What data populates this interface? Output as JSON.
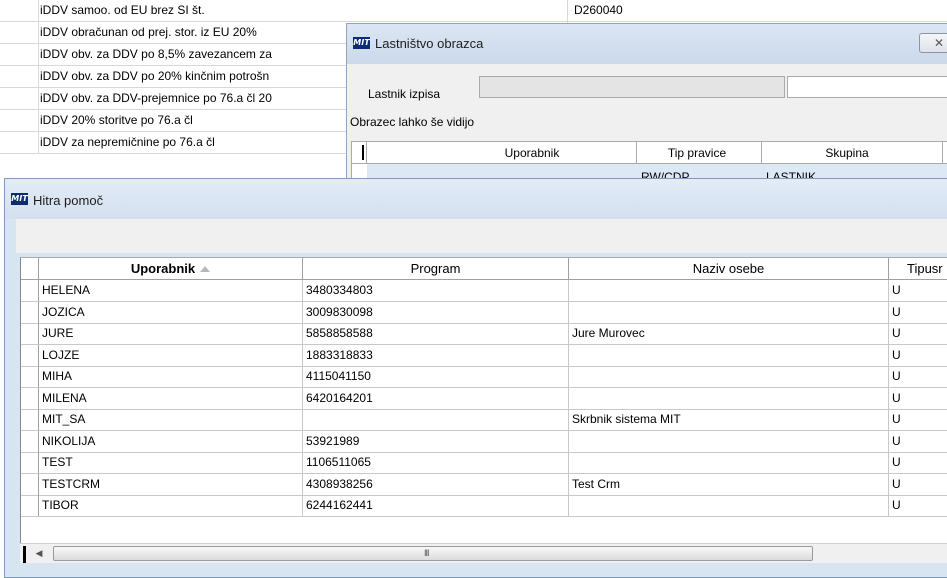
{
  "background_list": {
    "rows": [
      {
        "label": "iDDV samoo. od EU brez SI št.",
        "code": "D260040"
      },
      {
        "label": "iDDV obračunan od prej. stor. iz EU 20%",
        "code": ""
      },
      {
        "label": "iDDV obv. za DDV po 8,5% zavezancem za",
        "code": ""
      },
      {
        "label": "iDDV obv. za DDV po 20% kinčnim potrošn",
        "code": ""
      },
      {
        "label": "iDDV obv. za DDV-prejemnice po 76.a čl 20",
        "code": ""
      },
      {
        "label": "iDDV 20% storitve po 76.a čl",
        "code": ""
      },
      {
        "label": "iDDV za nepremičnine po 76.a čl",
        "code": ""
      }
    ]
  },
  "ownership_window": {
    "title": "Lastništvo obrazca",
    "logo_text": "MIT",
    "close_icon": "close-icon",
    "owner_label": "Lastnik izpisa",
    "owner_value": "",
    "visible_label": "Obrazec lahko še vidijo",
    "columns": [
      "Uporabnik",
      "Tip pravice",
      "Skupina"
    ],
    "first_row": {
      "user": "",
      "right_type": "RW/CDP",
      "group": "LASTNIK"
    }
  },
  "help_window": {
    "title": "Hitra pomoč",
    "logo_text": "MIT",
    "columns": [
      "Uporabnik",
      "Program",
      "Naziv osebe",
      "Tipusr"
    ],
    "sort_icon": "sort-ascending-icon",
    "rows": [
      {
        "user": "HELENA",
        "program": "3480334803",
        "name": "",
        "type": "U"
      },
      {
        "user": "JOZICA",
        "program": "3009830098",
        "name": "",
        "type": "U"
      },
      {
        "user": "JURE",
        "program": "5858858588",
        "name": "Jure Murovec",
        "type": "U"
      },
      {
        "user": "LOJZE",
        "program": "1883318833",
        "name": "",
        "type": "U"
      },
      {
        "user": "MIHA",
        "program": "4115041150",
        "name": "",
        "type": "U"
      },
      {
        "user": "MILENA",
        "program": "6420164201",
        "name": "",
        "type": "U"
      },
      {
        "user": "MIT_SA",
        "program": "",
        "name": "Skrbnik sistema MIT",
        "type": "U"
      },
      {
        "user": "NIKOLIJA",
        "program": "53921989",
        "name": "",
        "type": "U"
      },
      {
        "user": "TEST",
        "program": "1106511065",
        "name": "",
        "type": "U"
      },
      {
        "user": "TESTCRM",
        "program": "4308938256",
        "name": "Test Crm",
        "type": "U"
      },
      {
        "user": "TIBOR",
        "program": "6244162441",
        "name": "",
        "type": "U"
      }
    ],
    "scroll_grip": "III"
  }
}
